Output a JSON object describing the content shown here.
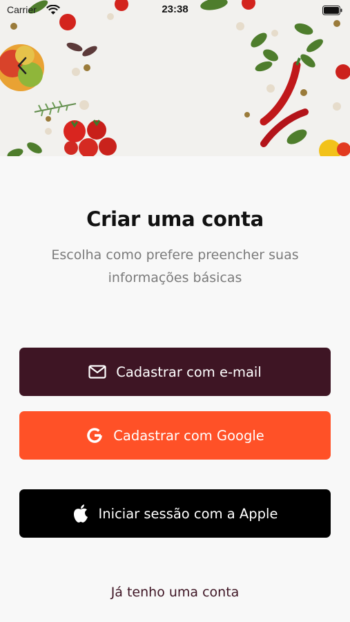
{
  "status_bar": {
    "carrier": "Carrier",
    "time": "23:38"
  },
  "hero": {
    "image": "vegetables-spices-background"
  },
  "header": {
    "back_icon": "chevron-left-icon"
  },
  "main": {
    "title": "Criar uma conta",
    "subtitle": "Escolha como prefere preencher suas informações básicas"
  },
  "buttons": {
    "email": {
      "label": "Cadastrar com e-mail",
      "icon": "mail-icon",
      "color": "#3e1524"
    },
    "google": {
      "label": "Cadastrar com Google",
      "icon": "google-icon",
      "color": "#ff5127"
    },
    "apple": {
      "label": "Iniciar sessão com a Apple",
      "icon": "apple-icon",
      "color": "#000000"
    }
  },
  "footer": {
    "login_link": "Já tenho uma conta"
  }
}
